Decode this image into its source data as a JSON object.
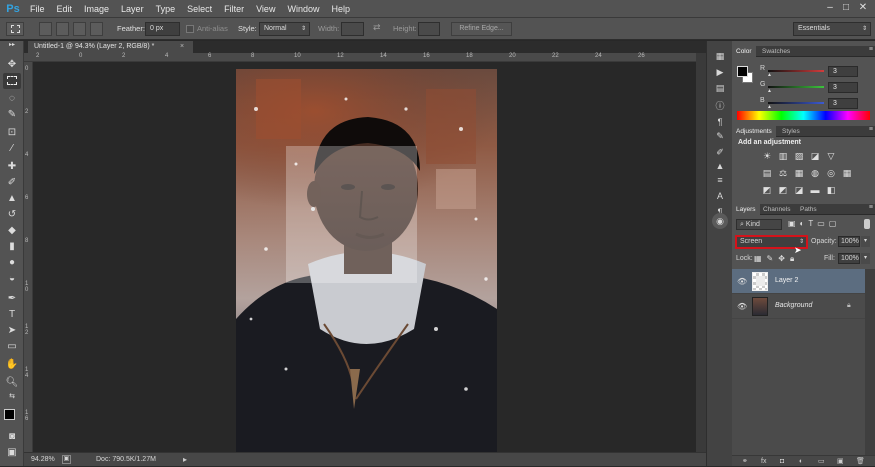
{
  "menubar": {
    "logo": "Ps",
    "items": [
      "File",
      "Edit",
      "Image",
      "Layer",
      "Type",
      "Select",
      "Filter",
      "View",
      "Window",
      "Help"
    ],
    "window_controls": [
      "–",
      "□",
      "✕"
    ]
  },
  "options_bar": {
    "feather_label": "Feather:",
    "feather_value": "0 px",
    "antialias_label": "Anti-alias",
    "style_label": "Style:",
    "style_value": "Normal",
    "width_label": "Width:",
    "height_label": "Height:",
    "refine_edge_label": "Refine Edge...",
    "workspace_value": "Essentials"
  },
  "document": {
    "tab_title": "Untitled-1 @ 94.3% (Layer 2, RGB/8) *",
    "tab_close": "×",
    "zoom": "94.28%",
    "doc_size": "Doc: 790.5K/1.27M"
  },
  "ruler": {
    "top_ticks": [
      "2",
      "0",
      "2",
      "4",
      "6",
      "8",
      "10",
      "12",
      "14",
      "16",
      "18",
      "20",
      "22",
      "24",
      "26"
    ],
    "left_ticks": [
      "0",
      "2",
      "4",
      "6",
      "8",
      "1 0",
      "1 2",
      "1 4",
      "1 6",
      "1 8"
    ]
  },
  "color_panel": {
    "tabs": [
      "Color",
      "Swatches"
    ],
    "channels": [
      {
        "label": "R",
        "value": "3",
        "color": "#d23c3c"
      },
      {
        "label": "G",
        "value": "3",
        "color": "#3cc43c"
      },
      {
        "label": "B",
        "value": "3",
        "color": "#3c5ad2"
      }
    ]
  },
  "adjustments_panel": {
    "tabs": [
      "Adjustments",
      "Styles"
    ],
    "heading": "Add an adjustment",
    "row1": [
      "☀",
      "▥",
      "▨",
      "◪",
      "▽"
    ],
    "row2": [
      "▤",
      "⚖",
      "▦",
      "◍",
      "◎",
      "▦"
    ],
    "row3": [
      "◩",
      "◩",
      "◪",
      "▬",
      "◧"
    ]
  },
  "layers_panel": {
    "tabs": [
      "Layers",
      "Channels",
      "Paths"
    ],
    "kind_label": "Kind",
    "blend_mode": "Screen",
    "opacity_label": "Opacity:",
    "opacity_value": "100%",
    "lock_label": "Lock:",
    "fill_label": "Fill:",
    "fill_value": "100%",
    "layers": [
      {
        "name": "Layer 2",
        "selected": true,
        "italic": false
      },
      {
        "name": "Background",
        "selected": false,
        "italic": true
      }
    ],
    "footer_icons": [
      "⚭",
      "fx",
      "◘",
      "◐",
      "▭",
      "▣",
      "🗑"
    ]
  },
  "colors": {
    "accent_blue": "#33a3e0",
    "highlight_red": "#d4131b",
    "selected_layer": "#5c6d80"
  }
}
